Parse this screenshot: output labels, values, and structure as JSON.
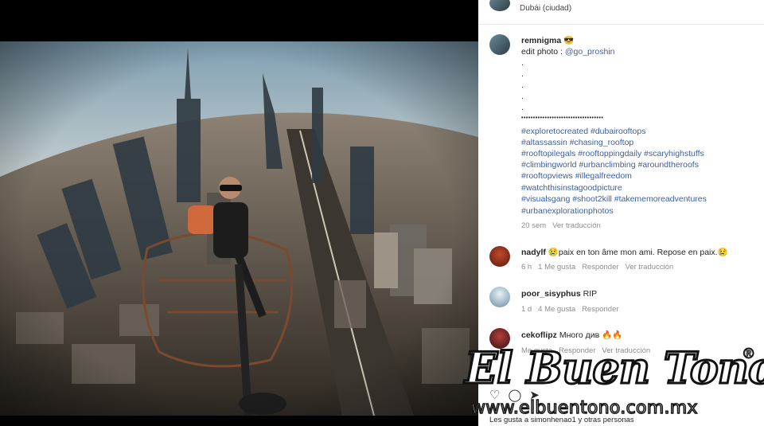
{
  "header": {
    "location": "Dubái (ciudad)"
  },
  "caption": {
    "username": "remnigma",
    "emoji": "😎",
    "edit_prefix": "edit photo : ",
    "edit_handle": "@go_proshin",
    "dots": [
      ".",
      ".",
      ".",
      ".",
      "."
    ],
    "separator": "•••••••••••••••••••••••••••••••••••",
    "hashtag_lines": [
      "#exploretocreated #dubairooftops",
      "#altassassin #chasing_rooftop",
      "#rooftopilegals #rooftoppingdaily #scaryhighstuffs",
      "#climbingworld #urbanclimbing #aroundtheroofs",
      "#rooftopviews #illegalfreedom",
      "#watchthisinstagoodpicture",
      "#visualsgang #shoot2kill #takememoreadventures",
      "#urbanexplorationphotos"
    ],
    "time": "20 sem",
    "translate": "Ver traducción"
  },
  "comments": [
    {
      "username": "nadylf",
      "text": "😢paix en ton âme mon ami. Repose en paix.😢",
      "time": "6 h",
      "likes": "1 Me gusta",
      "reply": "Responder",
      "translate": "Ver traducción"
    },
    {
      "username": "poor_sisyphus",
      "text": "RIP",
      "time": "1 d",
      "likes": "4 Me gusta",
      "reply": "Responder"
    },
    {
      "username": "cekoflipz",
      "text": "Много див 🔥🔥",
      "time": "",
      "likes": "Me gusta",
      "reply": "Responder",
      "translate": "Ver traducción"
    }
  ],
  "footer": {
    "likes_text": "Les gusta a simonhenao1 y otras personas"
  },
  "watermark": {
    "title": "El Buen Tono",
    "registered": "®",
    "url": "www.elbuentono.com.mx"
  },
  "icons": [
    "heart-icon",
    "comment-icon",
    "share-icon"
  ]
}
